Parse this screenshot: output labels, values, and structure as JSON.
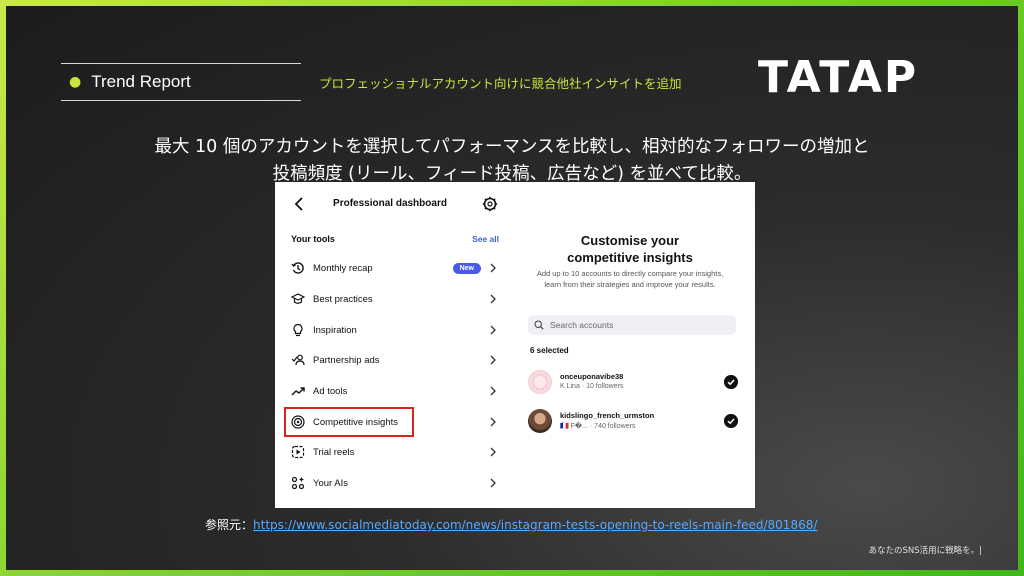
{
  "header": {
    "section_label": "Trend Report",
    "subtitle": "プロフェッショナルアカウント向けに競合他社インサイトを追加",
    "logo": "TATAP"
  },
  "headline": {
    "line1": "最大 10 個のアカウントを選択してパフォーマンスを比較し、相対的なフォロワーの増加と",
    "line2": "投稿頻度 (リール、フィード投稿、広告など) を並べて比較。"
  },
  "screenshot": {
    "left_panel": {
      "title": "Professional dashboard",
      "section_title": "Your tools",
      "see_all": "See all",
      "tools": [
        {
          "label": "Monthly recap",
          "icon": "monthly-recap-icon",
          "badge": "New"
        },
        {
          "label": "Best practices",
          "icon": "graduation-cap-icon"
        },
        {
          "label": "Inspiration",
          "icon": "lightbulb-icon"
        },
        {
          "label": "Partnership ads",
          "icon": "partnership-icon"
        },
        {
          "label": "Ad tools",
          "icon": "trend-arrow-icon"
        },
        {
          "label": "Competitive insights",
          "icon": "target-icon",
          "highlighted": true
        },
        {
          "label": "Trial reels",
          "icon": "reels-icon"
        },
        {
          "label": "Your AIs",
          "icon": "ai-sparkle-icon"
        }
      ]
    },
    "right_panel": {
      "title_line1": "Customise your",
      "title_line2": "competitive insights",
      "description": "Add up to 10 accounts to directly compare your insights, learn from their strategies and improve your results.",
      "search_placeholder": "Search accounts",
      "selected_count": "6 selected",
      "accounts": [
        {
          "name": "onceuponavibe38",
          "meta": "K Lina · 10 followers"
        },
        {
          "name": "kidslingo_french_urmston",
          "meta": "🇫🇷 F�... · 740 followers"
        }
      ]
    }
  },
  "reference": {
    "label": "参照元：",
    "url": "https://www.socialmediatoday.com/news/instagram-tests-opening-to-reels-main-feed/801868/"
  },
  "footer": "あなたのSNS活用に戦略を。|",
  "colors": {
    "accent": "#c6e63a",
    "highlight_border": "#d8251c",
    "badge": "#4a5ae8",
    "link": "#5aa8ff"
  }
}
